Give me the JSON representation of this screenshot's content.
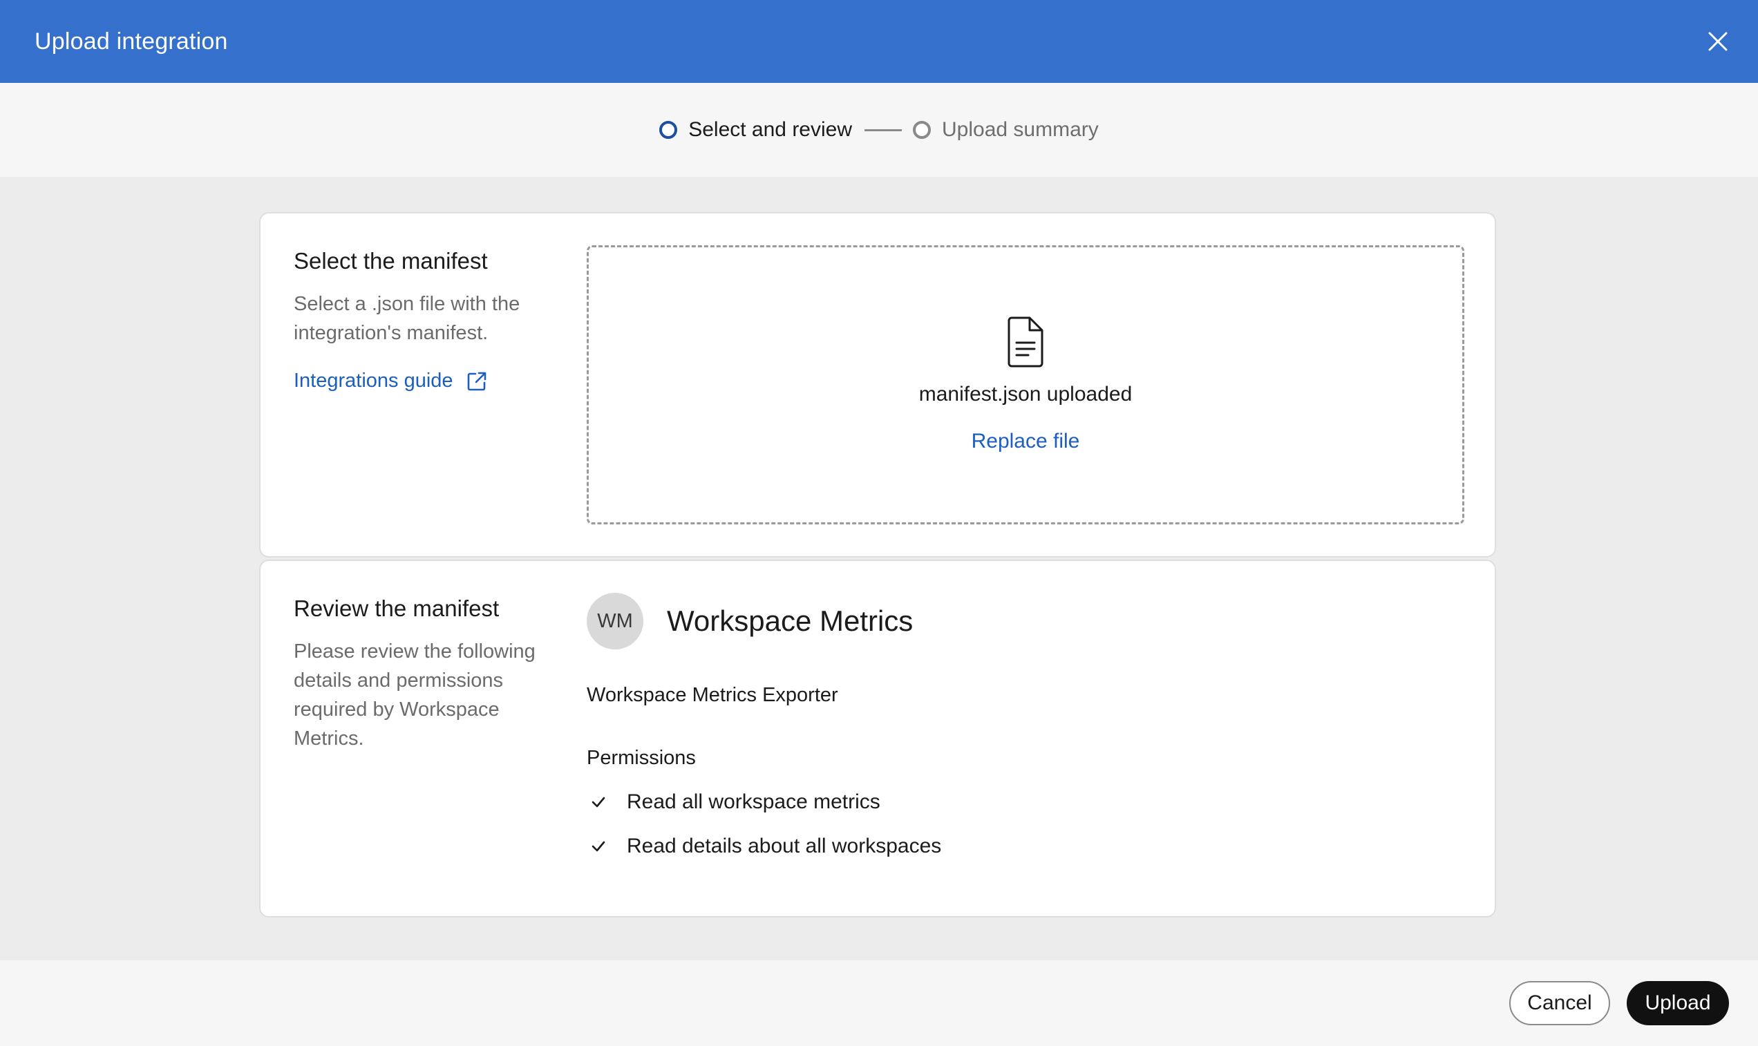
{
  "header": {
    "title": "Upload integration",
    "close_icon": "close-icon"
  },
  "stepper": {
    "steps": [
      {
        "label": "Select and review",
        "state": "active"
      },
      {
        "label": "Upload summary",
        "state": "inactive"
      }
    ]
  },
  "select_manifest": {
    "heading": "Select the manifest",
    "description": "Select a .json file with the integration's manifest.",
    "guide_link": "Integrations guide",
    "guide_icon": "external-link-icon",
    "dropzone": {
      "file_icon": "file-icon",
      "status": "manifest.json uploaded",
      "replace_label": "Replace file"
    }
  },
  "review_manifest": {
    "heading": "Review the manifest",
    "description": "Please review the following details and permissions required by Workspace Metrics.",
    "avatar_initials": "WM",
    "app_name": "Workspace Metrics",
    "app_description": "Workspace Metrics Exporter",
    "permissions_title": "Permissions",
    "permissions": [
      "Read all workspace metrics",
      "Read details about all workspaces"
    ]
  },
  "footer": {
    "cancel_label": "Cancel",
    "upload_label": "Upload"
  },
  "colors": {
    "header_bg": "#3570cc",
    "link": "#1c5fc0",
    "active_step": "#1c4f9e",
    "primary_button": "#111111"
  }
}
